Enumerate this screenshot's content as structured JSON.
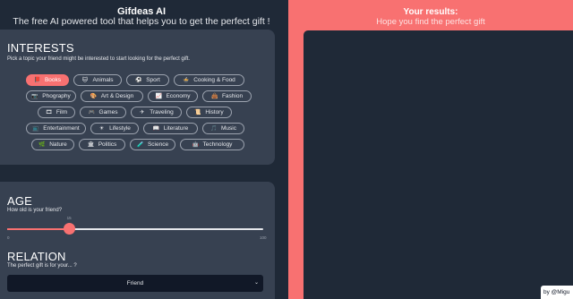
{
  "header": {
    "title": "Gifdeas AI",
    "subtitle": "The free AI powered tool that helps you to get the perfect gift !"
  },
  "interests": {
    "heading": "INTERESTS",
    "hint": "Pick a topic your friend might be interested to start looking for the perfect gift.",
    "selected": "Books",
    "chips": [
      {
        "label": "Books",
        "icon": "book-icon",
        "glyph": "📕",
        "active": true
      },
      {
        "label": "Animals",
        "icon": "paw-icon",
        "glyph": "🐱",
        "active": false
      },
      {
        "label": "Sport",
        "icon": "ball-icon",
        "glyph": "⚽",
        "active": false
      },
      {
        "label": "Cooking & Food",
        "icon": "pot-icon",
        "glyph": "🍲",
        "active": false
      },
      {
        "label": "Phography",
        "icon": "camera-icon",
        "glyph": "📷",
        "active": false
      },
      {
        "label": "Art & Design",
        "icon": "palette-icon",
        "glyph": "🎨",
        "active": false
      },
      {
        "label": "Economy",
        "icon": "chart-icon",
        "glyph": "📈",
        "active": false
      },
      {
        "label": "Fashion",
        "icon": "bag-icon",
        "glyph": "👜",
        "active": false
      },
      {
        "label": "Film",
        "icon": "film-icon",
        "glyph": "🎞",
        "active": false
      },
      {
        "label": "Games",
        "icon": "gamepad-icon",
        "glyph": "🎮",
        "active": false
      },
      {
        "label": "Traveling",
        "icon": "plane-icon",
        "glyph": "✈",
        "active": false
      },
      {
        "label": "History",
        "icon": "scroll-icon",
        "glyph": "📜",
        "active": false
      },
      {
        "label": "Entertainment",
        "icon": "tv-icon",
        "glyph": "📺",
        "active": false
      },
      {
        "label": "Lifestyle",
        "icon": "sun-icon",
        "glyph": "☀",
        "active": false
      },
      {
        "label": "Literature",
        "icon": "open-book-icon",
        "glyph": "📖",
        "active": false
      },
      {
        "label": "Music",
        "icon": "music-icon",
        "glyph": "🎵",
        "active": false
      },
      {
        "label": "Nature",
        "icon": "leaf-icon",
        "glyph": "🌿",
        "active": false
      },
      {
        "label": "Politics",
        "icon": "building-icon",
        "glyph": "🏛",
        "active": false
      },
      {
        "label": "Science",
        "icon": "flask-icon",
        "glyph": "🧪",
        "active": false
      },
      {
        "label": "Technology",
        "icon": "robot-icon",
        "glyph": "🤖",
        "active": false
      }
    ]
  },
  "age": {
    "heading": "AGE",
    "hint": "How old is your friend?",
    "value": 15,
    "min": 0,
    "max": 100,
    "value_label": "15",
    "min_label": "0",
    "max_label": "100"
  },
  "relation": {
    "heading": "RELATION",
    "hint": "The perfect gift is for your... ?",
    "selected": "Friend"
  },
  "results": {
    "title": "Your results:",
    "subtitle": "Hope you find the perfect gift"
  },
  "credit": "by @Migu",
  "colors": {
    "accent": "#f87171",
    "panel": "#374151",
    "background": "#1f2937"
  }
}
